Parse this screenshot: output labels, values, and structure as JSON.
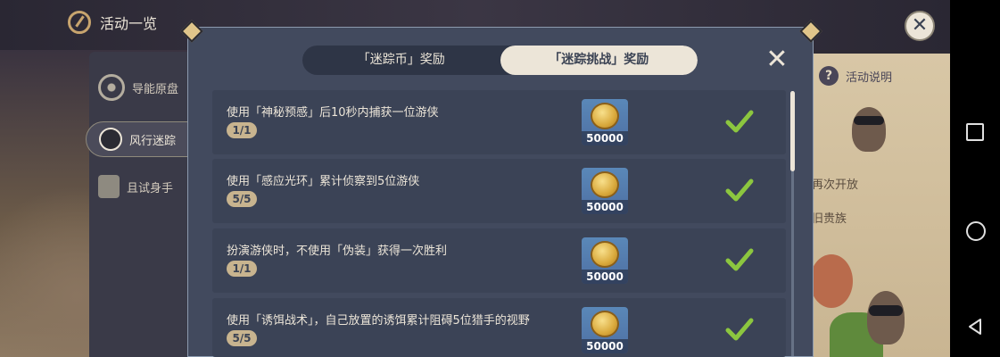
{
  "app": {
    "title": "活动一览"
  },
  "sidebar": {
    "items": [
      {
        "label": "导能原盘"
      },
      {
        "label": "风行迷踪"
      },
      {
        "label": "且试身手"
      }
    ]
  },
  "help": {
    "label": "活动说明"
  },
  "background_text": [
    "再次开放",
    "旧贵族"
  ],
  "modal": {
    "tabs": [
      {
        "label": "「迷踪币」奖励",
        "active": false
      },
      {
        "label": "「迷踪挑战」奖励",
        "active": true
      }
    ],
    "challenges": [
      {
        "description": "使用「神秘预感」后10秒内捕获一位游侠",
        "progress": "1/1",
        "reward_count": "50000",
        "completed": true
      },
      {
        "description": "使用「感应光环」累计侦察到5位游侠",
        "progress": "5/5",
        "reward_count": "50000",
        "completed": true
      },
      {
        "description": "扮演游侠时，不使用「伪装」获得一次胜利",
        "progress": "1/1",
        "reward_count": "50000",
        "completed": true
      },
      {
        "description": "使用「诱饵战术」，自己放置的诱饵累计阻碍5位猎手的视野",
        "progress": "5/5",
        "reward_count": "50000",
        "completed": true
      }
    ]
  },
  "colors": {
    "accent_cream": "#ece5d8",
    "panel": "#424a5e",
    "row": "#3b4356",
    "check_green": "#8cc63f",
    "progress_badge": "#c8b48f"
  },
  "icons": {
    "app": "compass-icon",
    "close_outer": "close-icon",
    "modal_close": "close-icon",
    "check": "check-icon",
    "reward": "mora-coin-icon"
  }
}
